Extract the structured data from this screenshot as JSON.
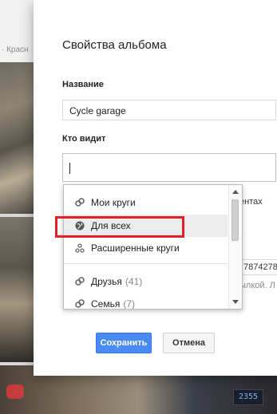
{
  "background": {
    "breadcrumb": "· Красн",
    "meter_reading": "2355"
  },
  "dialog": {
    "title": "Свойства альбома",
    "name_label": "Название",
    "name_value": "Cycle garage",
    "who_label": "Кто видит",
    "who_value": "",
    "behind_text_1": "ентах",
    "behind_text_2": "7874278",
    "behind_text_3": "ылкой. Л"
  },
  "dropdown": {
    "items": [
      {
        "label": "Мои круги",
        "icon": "circles-icon"
      },
      {
        "label": "Для всех",
        "icon": "globe-icon",
        "highlighted": true
      },
      {
        "label": "Расширенные круги",
        "icon": "extended-circles-icon"
      },
      {
        "label": "Друзья",
        "count": "(41)",
        "icon": "circles-icon"
      },
      {
        "label": "Семья",
        "count": "(7)",
        "icon": "circles-icon"
      }
    ]
  },
  "buttons": {
    "save": "Сохранить",
    "cancel": "Отмена"
  },
  "colors": {
    "accent": "#4a8af4",
    "highlight_box": "#e3202a"
  }
}
